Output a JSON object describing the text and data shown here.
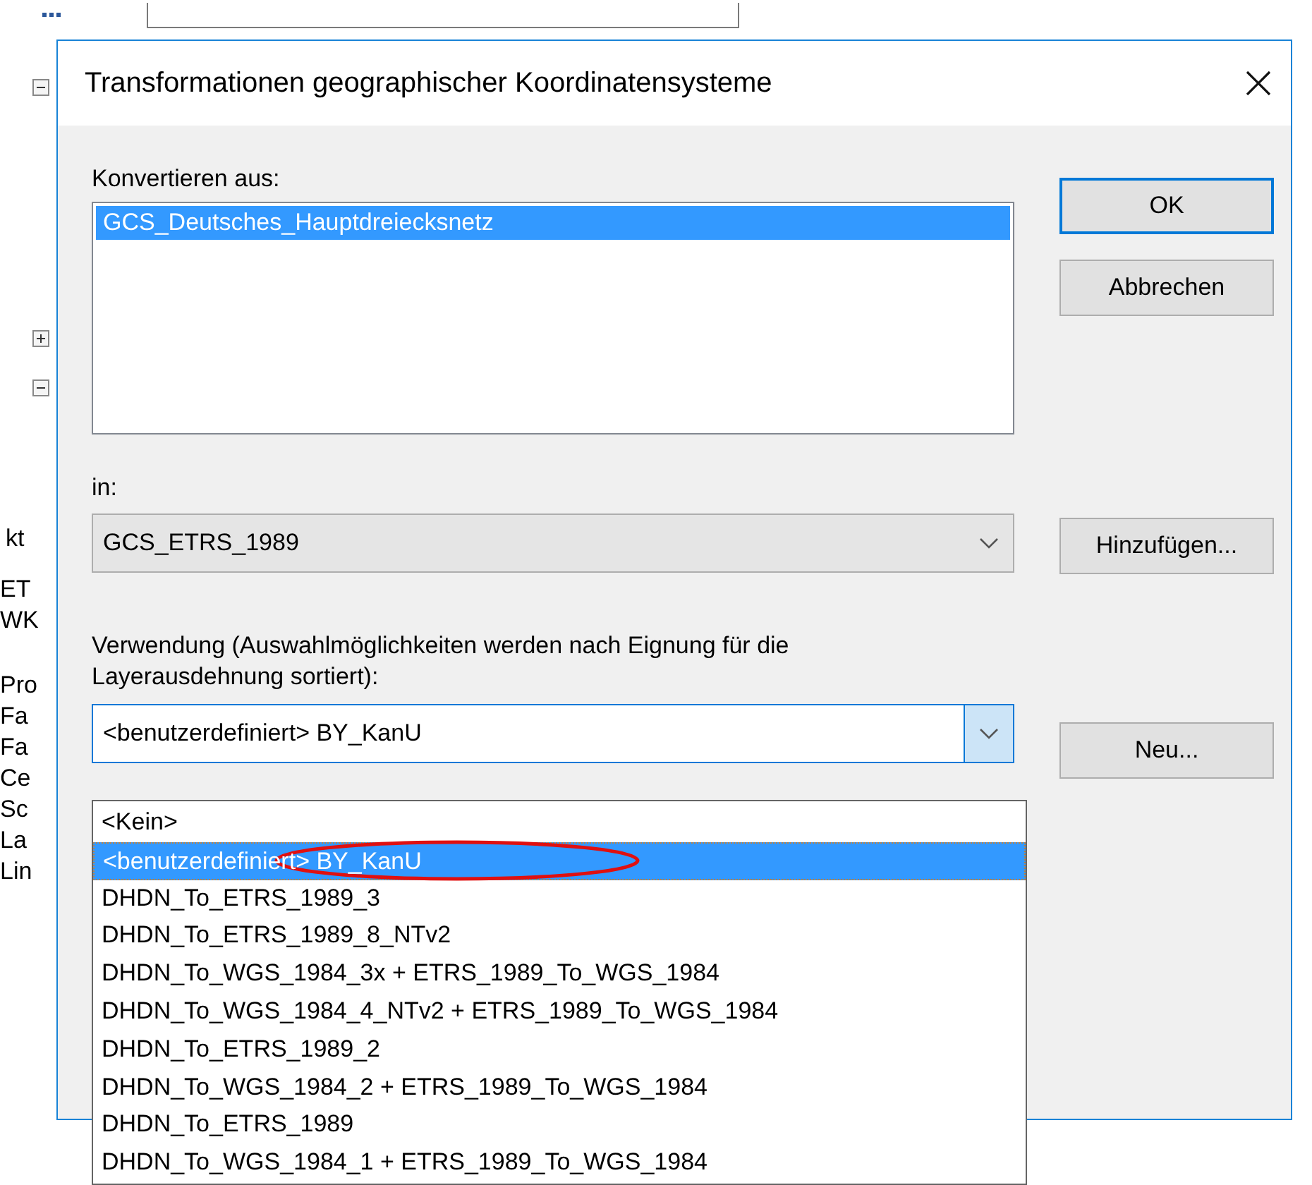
{
  "background": {
    "side_texts": [
      "kt",
      "ET",
      "WK",
      "Pro",
      "Fa",
      "Fa",
      "Ce",
      "Sc",
      "La",
      "Lin"
    ]
  },
  "dialog": {
    "title": "Transformationen geographischer Koordinatensysteme",
    "source": {
      "label": "Konvertieren aus:",
      "items": [
        {
          "text": "GCS_Deutsches_Hauptdreiecksnetz",
          "selected": true
        }
      ]
    },
    "target": {
      "label": "in:",
      "value": "GCS_ETRS_1989",
      "button": "Hinzufügen..."
    },
    "transformation": {
      "label": "Verwendung (Auswahlmöglichkeiten werden nach Eignung für die Layerausdehnung sortiert):",
      "value": "<benutzerdefiniert> BY_KanU",
      "expanded": true,
      "button": "Neu...",
      "options": [
        {
          "text": "<Kein>",
          "selected": false,
          "circled": false
        },
        {
          "text": "<benutzerdefiniert> BY_KanU",
          "selected": true,
          "circled": true
        },
        {
          "text": "DHDN_To_ETRS_1989_3",
          "selected": false,
          "circled": false
        },
        {
          "text": "DHDN_To_ETRS_1989_8_NTv2",
          "selected": false,
          "circled": false
        },
        {
          "text": "DHDN_To_WGS_1984_3x + ETRS_1989_To_WGS_1984",
          "selected": false,
          "circled": false
        },
        {
          "text": "DHDN_To_WGS_1984_4_NTv2 + ETRS_1989_To_WGS_1984",
          "selected": false,
          "circled": false
        },
        {
          "text": "DHDN_To_ETRS_1989_2",
          "selected": false,
          "circled": false
        },
        {
          "text": "DHDN_To_WGS_1984_2 + ETRS_1989_To_WGS_1984",
          "selected": false,
          "circled": false
        },
        {
          "text": "DHDN_To_ETRS_1989",
          "selected": false,
          "circled": false
        },
        {
          "text": "DHDN_To_WGS_1984_1 + ETRS_1989_To_WGS_1984",
          "selected": false,
          "circled": false
        }
      ]
    },
    "buttons": [
      {
        "label": "OK",
        "default": true
      },
      {
        "label": "Abbrechen",
        "default": false
      }
    ]
  }
}
